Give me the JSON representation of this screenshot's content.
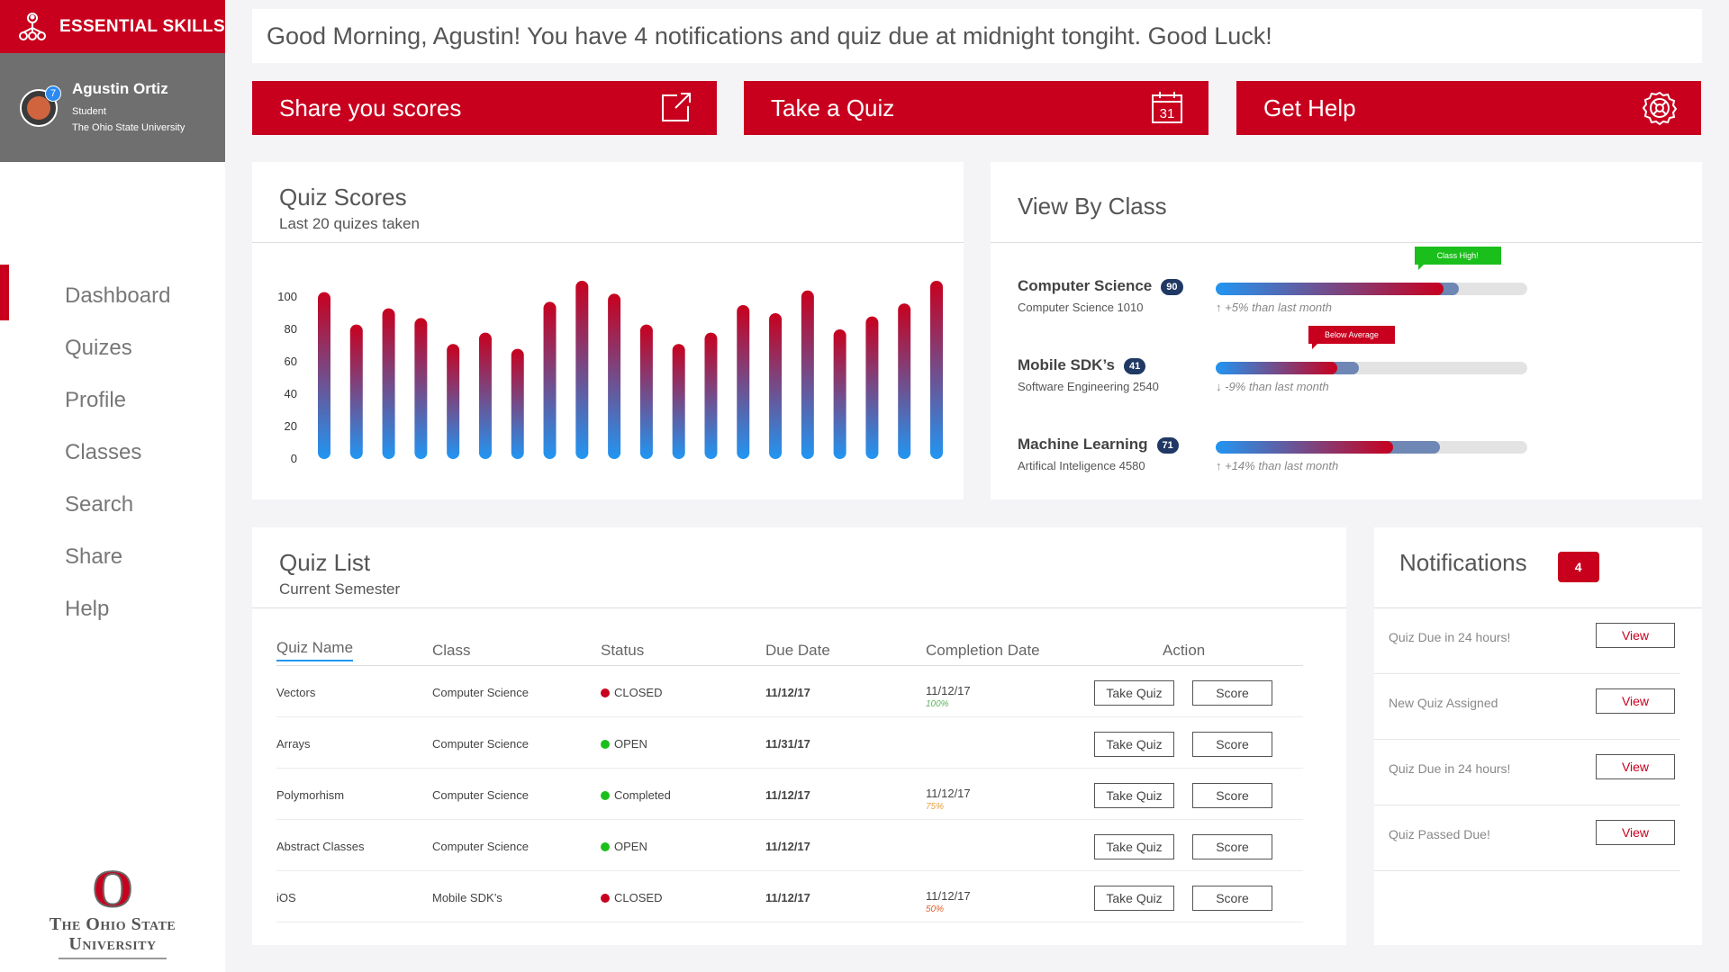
{
  "brand": {
    "name": "ESSENTIAL SKILLS"
  },
  "user": {
    "name": "Agustin Ortiz",
    "role": "Student",
    "school": "The Ohio State University",
    "badge": "7"
  },
  "nav": [
    {
      "label": "Dashboard",
      "active": true
    },
    {
      "label": "Quizes"
    },
    {
      "label": "Profile"
    },
    {
      "label": "Classes"
    },
    {
      "label": "Search"
    },
    {
      "label": "Share"
    },
    {
      "label": "Help"
    }
  ],
  "logo": {
    "line1": "The Ohio State",
    "line2": "University"
  },
  "greeting": "Good Morning, Agustin! You have 4 notifications and quiz due at midnight tongiht. Good Luck!",
  "actions": [
    {
      "label": "Share you scores",
      "icon": "external-link-icon"
    },
    {
      "label": "Take a Quiz",
      "icon": "calendar-icon",
      "icon_text": "31"
    },
    {
      "label": "Get Help",
      "icon": "help-gear-icon"
    }
  ],
  "quiz_scores": {
    "title": "Quiz Scores",
    "subtitle": "Last 20 quizes taken"
  },
  "chart_data": {
    "type": "bar",
    "title": "",
    "xlabel": "",
    "ylabel": "",
    "ylim": [
      0,
      100
    ],
    "yticks": [
      0,
      20,
      40,
      60,
      80,
      100
    ],
    "values": [
      103,
      83,
      93,
      87,
      71,
      78,
      68,
      97,
      110,
      102,
      83,
      71,
      78,
      95,
      90,
      104,
      80,
      88,
      96,
      110
    ],
    "gradient": [
      "#c8001e",
      "#2196f3"
    ],
    "grid": false
  },
  "view_by_class": {
    "title": "View By Class",
    "classes": [
      {
        "name": "Computer Science",
        "count": "90",
        "course": "Computer Science 1010",
        "trend": "↑ +5% than last month",
        "inner": 0.73,
        "outer": 0.78,
        "flag": "Class High!",
        "flag_color": "#1bbf1b"
      },
      {
        "name": "Mobile SDK’s",
        "count": "41",
        "course": "Software Engineering 2540",
        "trend": "↓ -9% than last month",
        "inner": 0.39,
        "outer": 0.46,
        "flag": "Below Average",
        "flag_color": "#c8001e"
      },
      {
        "name": "Machine Learning",
        "count": "71",
        "course": "Artifical Inteligence 4580",
        "trend": "↑ +14% than last month",
        "inner": 0.57,
        "outer": 0.72,
        "flag": "",
        "flag_color": ""
      }
    ]
  },
  "quiz_list": {
    "title": "Quiz List",
    "subtitle": "Current Semester",
    "columns": [
      "Quiz Name",
      "Class",
      "Status",
      "Due Date",
      "Completion Date",
      "Action"
    ],
    "take_label": "Take Quiz",
    "score_label": "Score",
    "rows": [
      {
        "name": "Vectors",
        "class": "Computer Science",
        "status": "CLOSED",
        "status_color": "#c8001e",
        "due": "11/12/17",
        "completed": "11/12/17",
        "pct": "100%",
        "pct_color": "#5cb85c"
      },
      {
        "name": "Arrays",
        "class": "Computer Science",
        "status": "OPEN",
        "status_color": "#1bbf1b",
        "due": "11/31/17",
        "completed": "",
        "pct": "",
        "pct_color": ""
      },
      {
        "name": "Polymorhism",
        "class": "Computer Science",
        "status": "Completed",
        "status_color": "#1bbf1b",
        "due": "11/12/17",
        "completed": "11/12/17",
        "pct": "75%",
        "pct_color": "#e8a040"
      },
      {
        "name": "Abstract Classes",
        "class": "Computer Science",
        "status": "OPEN",
        "status_color": "#1bbf1b",
        "due": "11/12/17",
        "completed": "",
        "pct": "",
        "pct_color": ""
      },
      {
        "name": "iOS",
        "class": "Mobile SDK’s",
        "status": "CLOSED",
        "status_color": "#c8001e",
        "due": "11/12/17",
        "completed": "11/12/17",
        "pct": "50%",
        "pct_color": "#e06030"
      }
    ]
  },
  "notifications": {
    "title": "Notifications",
    "count": "4",
    "view_label": "View",
    "items": [
      {
        "text": "Quiz Due in 24 hours!"
      },
      {
        "text": "New Quiz Assigned"
      },
      {
        "text": "Quiz Due in 24 hours!"
      },
      {
        "text": "Quiz Passed Due!"
      }
    ]
  }
}
